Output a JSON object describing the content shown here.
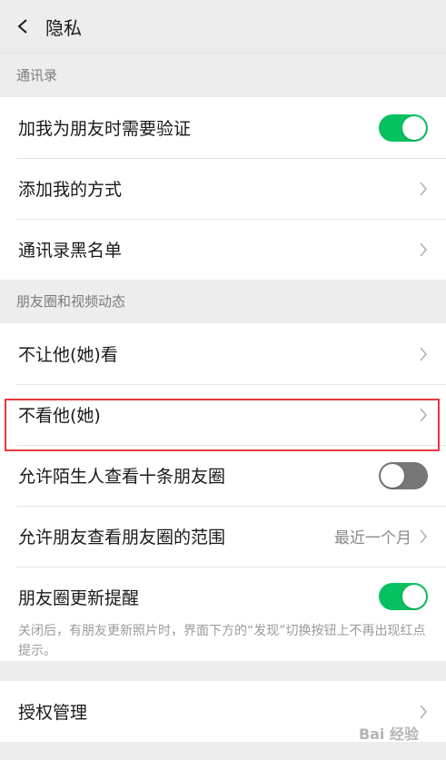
{
  "header": {
    "title": "隐私"
  },
  "sections": {
    "contacts_label": "通讯录",
    "moments_label": "朋友圈和视频动态"
  },
  "contacts": {
    "verify": "加我为朋友时需要验证",
    "add_methods": "添加我的方式",
    "blacklist": "通讯录黑名单"
  },
  "moments": {
    "dont_let_see": "不让他(她)看",
    "dont_see": "不看他(她)",
    "stranger_ten": "允许陌生人查看十条朋友圈",
    "friend_range": "允许朋友查看朋友圈的范围",
    "friend_range_value": "最近一个月",
    "update_reminder": "朋友圈更新提醒",
    "update_hint": "关闭后，有朋友更新照片时，界面下方的“发现”切换按钮上不再出现红点提示。"
  },
  "auth": {
    "label": "授权管理"
  },
  "watermark": "Bai 经验",
  "colors": {
    "accent": "#07c160",
    "highlight": "#e8393e"
  }
}
